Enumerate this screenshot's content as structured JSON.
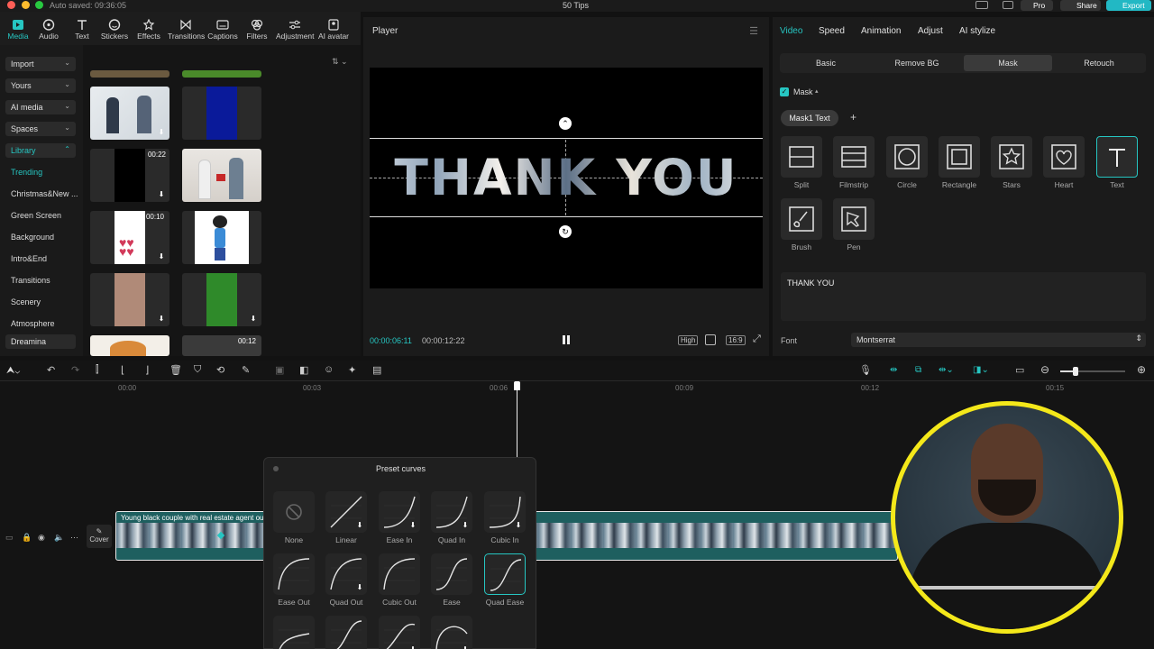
{
  "titlebar": {
    "autosave": "Auto saved: 09:36:05",
    "project": "50 Tips",
    "pro": "Pro",
    "share": "Share",
    "export": "Export"
  },
  "toolbar": {
    "items": [
      "Media",
      "Audio",
      "Text",
      "Stickers",
      "Effects",
      "Transitions",
      "Captions",
      "Filters",
      "Adjustment",
      "AI avatar"
    ]
  },
  "sidebar": {
    "buttons": [
      "Import",
      "Yours",
      "AI media",
      "Spaces",
      "Library"
    ],
    "items": [
      "Trending",
      "Christmas&New ...",
      "Green Screen",
      "Background",
      "Intro&End",
      "Transitions",
      "Scenery",
      "Atmosphere"
    ],
    "dreamina": "Dreamina"
  },
  "media": {
    "durations": [
      "00:22",
      "00:10",
      "00:12"
    ]
  },
  "player": {
    "title": "Player",
    "overlay_text": "THANK YOU",
    "current_time": "00:00:06:11",
    "total_time": "00:00:12:22",
    "quality": "High",
    "ratio": "16:9"
  },
  "right": {
    "tabs": [
      "Video",
      "Speed",
      "Animation",
      "Adjust",
      "AI stylize"
    ],
    "subtabs": [
      "Basic",
      "Remove BG",
      "Mask",
      "Retouch"
    ],
    "mask_label": "Mask",
    "mask_chip": "Mask1 Text",
    "shapes": [
      "Split",
      "Filmstrip",
      "Circle",
      "Rectangle",
      "Stars",
      "Heart",
      "Text",
      "Brush",
      "Pen"
    ],
    "text_value": "THANK YOU",
    "font_label": "Font",
    "font_value": "Montserrat"
  },
  "timeline": {
    "ticks": [
      "00:00",
      "00:03",
      "00:06",
      "00:09",
      "00:12",
      "00:15"
    ],
    "clip_title": "Young black couple with real estate agent out",
    "cover": "Cover"
  },
  "curves": {
    "title": "Preset curves",
    "items": [
      "None",
      "Linear",
      "Ease In",
      "Quad In",
      "Cubic In",
      "Ease Out",
      "Quad Out",
      "Cubic Out",
      "Ease",
      "Quad Ease"
    ]
  },
  "colors": {
    "accent": "#26c6c2",
    "export_bg": "#22b8c4",
    "webcam_ring": "#f4e81a"
  }
}
